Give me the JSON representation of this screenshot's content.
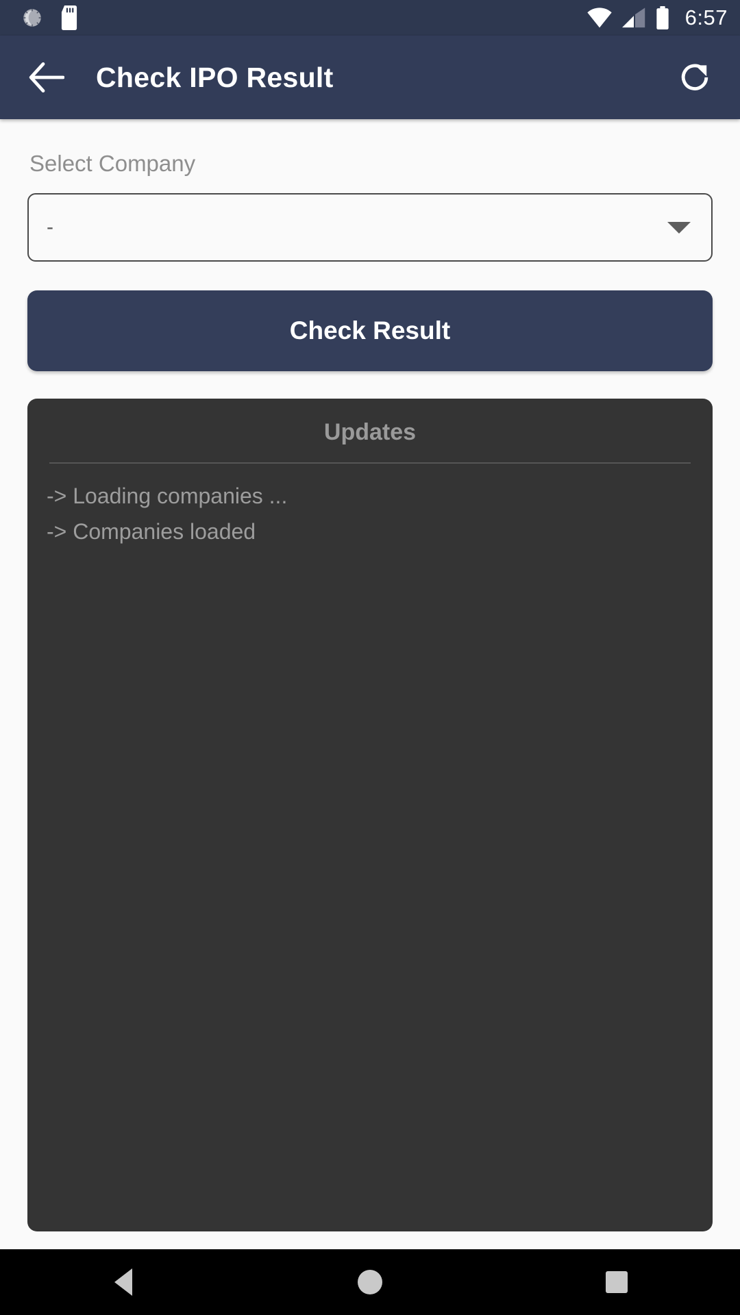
{
  "status_bar": {
    "time": "6:57",
    "icons_left": [
      "brightness-sun-icon",
      "sd-card-icon"
    ],
    "icons_right": [
      "wifi-icon",
      "cellular-signal-icon",
      "battery-icon"
    ],
    "background_color": "#2e3850"
  },
  "app_bar": {
    "back_icon": "back-arrow-icon",
    "title": "Check IPO Result",
    "refresh_icon": "refresh-icon",
    "background_color": "#323c58"
  },
  "form": {
    "company_label": "Select Company",
    "company_value": "-",
    "company_placeholder": "-",
    "dropdown_icon": "chevron-down-icon",
    "check_result_label": "Check Result",
    "button_color": "#343e5a"
  },
  "updates": {
    "title": "Updates",
    "lines": [
      "-> Loading companies ...",
      "-> Companies loaded"
    ],
    "panel_color": "#343434",
    "text_color": "#9d9d9d"
  },
  "nav_bar": {
    "back_label": "back-triangle-icon",
    "home_label": "home-circle-icon",
    "recents_label": "recents-square-icon"
  }
}
